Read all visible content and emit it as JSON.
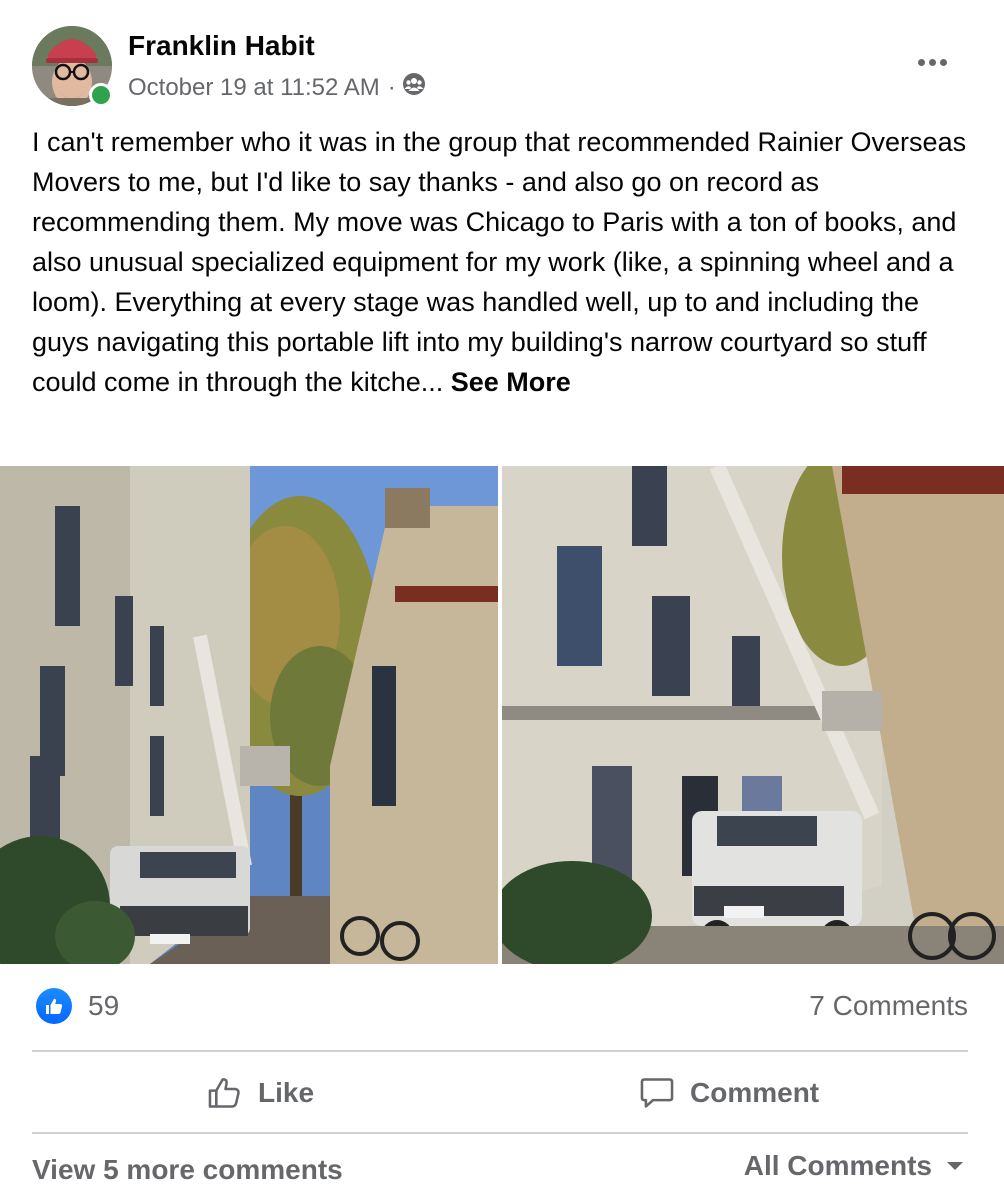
{
  "post": {
    "author": "Franklin Habit",
    "timestamp": "October 19 at 11:52 AM",
    "separator": "·",
    "audience_icon": "group-icon",
    "more_icon": "more-options-icon",
    "body": "I can't remember who it was in the group that recommended Rainier Overseas Movers to me, but I'd like to say thanks - and also go on record as recommending them. My move was Chicago to Paris with a ton of books, and also unusual specialized equipment for my work (like, a spinning wheel and a loom). Everything at every stage was handled well, up to and including the guys navigating this portable lift into my building's narrow courtyard so stuff could come in through the kitche...",
    "see_more": "See More",
    "online": true
  },
  "photos": [
    {
      "description": "courtyard-with-lift-and-tree"
    },
    {
      "description": "courtyard-with-truck-and-lift"
    }
  ],
  "reactions": {
    "like_count": "59",
    "comments_count": "7 Comments"
  },
  "actions": {
    "like_label": "Like",
    "comment_label": "Comment"
  },
  "comments": {
    "view_more": "View 5 more comments",
    "filter_label": "All Comments"
  },
  "colors": {
    "accent": "#0866ff",
    "secondary_text": "#65676b",
    "online": "#31a24c",
    "divider": "#ced0d4"
  }
}
